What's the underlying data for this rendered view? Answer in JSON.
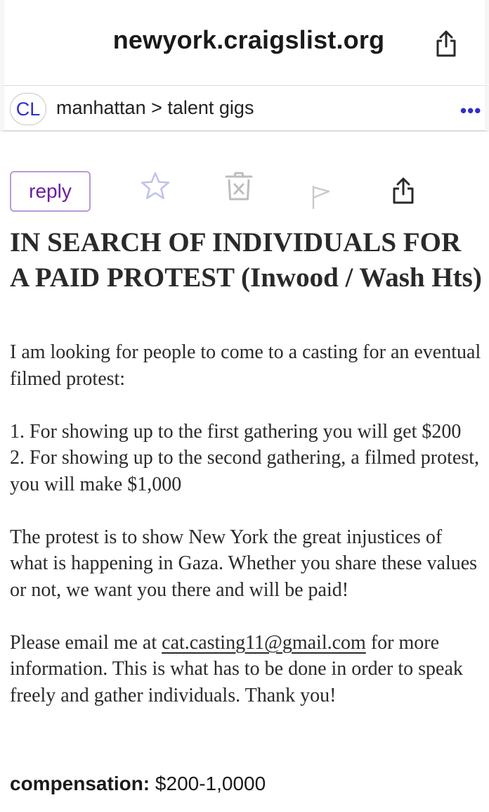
{
  "browser": {
    "url": "newyork.craigslist.org",
    "share_icon": "share-icon"
  },
  "nav": {
    "logo": "CL",
    "breadcrumb": "manhattan > talent gigs",
    "menu": "•••"
  },
  "toolbar": {
    "reply_label": "reply",
    "icons": [
      "star-icon",
      "hide-trash-icon",
      "flag-icon",
      "share-icon"
    ]
  },
  "post": {
    "title": "IN SEARCH OF INDIVIDUALS FOR A PAID PROTEST (Inwood / Wash Hts)",
    "intro": "I am looking for people to come to a casting for an eventual filmed protest:",
    "item1": "1. For showing up to the first gathering you will get $200",
    "item2": "2. For showing up to the second gathering, a filmed protest, you will make $1,000",
    "para2": "The protest is to show New York the great injustices of what is happening in Gaza. Whether you share these values or not, we want you there and will be paid!",
    "para3_before": "Please email me at ",
    "email": "cat.casting11@gmail.com",
    "para3_after": " for more information. This is what has to be done in order to speak freely and gather individuals. Thank you!"
  },
  "compensation": {
    "label": "compensation:",
    "value": "$200-1,0000"
  },
  "colors": {
    "link_blue": "#2e2ed1",
    "reply_purple": "#6a1ea0",
    "reply_border": "#b99ad6",
    "text": "#2a2a2a"
  }
}
